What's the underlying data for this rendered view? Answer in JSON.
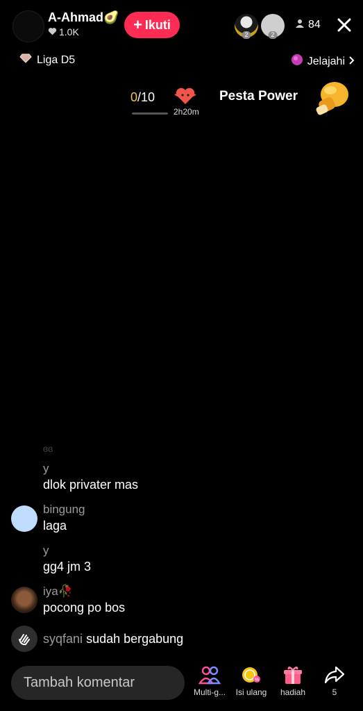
{
  "header": {
    "host_name": "A-Ahmad🥑",
    "host_likes": "1.0K",
    "follow_label": "Ikuti",
    "viewer_badge_1": "2",
    "viewer_badge_2": "2",
    "viewer_count": "84"
  },
  "subheader": {
    "league_label": "Liga D5",
    "explore_label": "Jelajahi"
  },
  "power_party": {
    "progress_current": "0",
    "progress_total": "/10",
    "progress_fraction": 0.0,
    "timer": "2h20m",
    "title": "Pesta Power"
  },
  "chat": {
    "faded_top": "ɞɞ",
    "messages": [
      {
        "user": "y",
        "text": "dlok privater mas"
      },
      {
        "user": "bingung",
        "text": "laga"
      },
      {
        "user": "y",
        "text": "gg4 jm 3"
      },
      {
        "user": "iya🥀",
        "text": "pocong po bos"
      }
    ],
    "join_user": "syqfani",
    "join_text": "sudah bergabung"
  },
  "bottom_bar": {
    "comment_placeholder": "Tambah komentar",
    "multi_label": "Multi-g...",
    "recharge_label": "Isi ulang",
    "gift_label": "hadiah",
    "share_count": "5"
  },
  "colors": {
    "follow": "#fe2c55",
    "progress_number": "#f2c744",
    "username": "#9b9b9b"
  }
}
